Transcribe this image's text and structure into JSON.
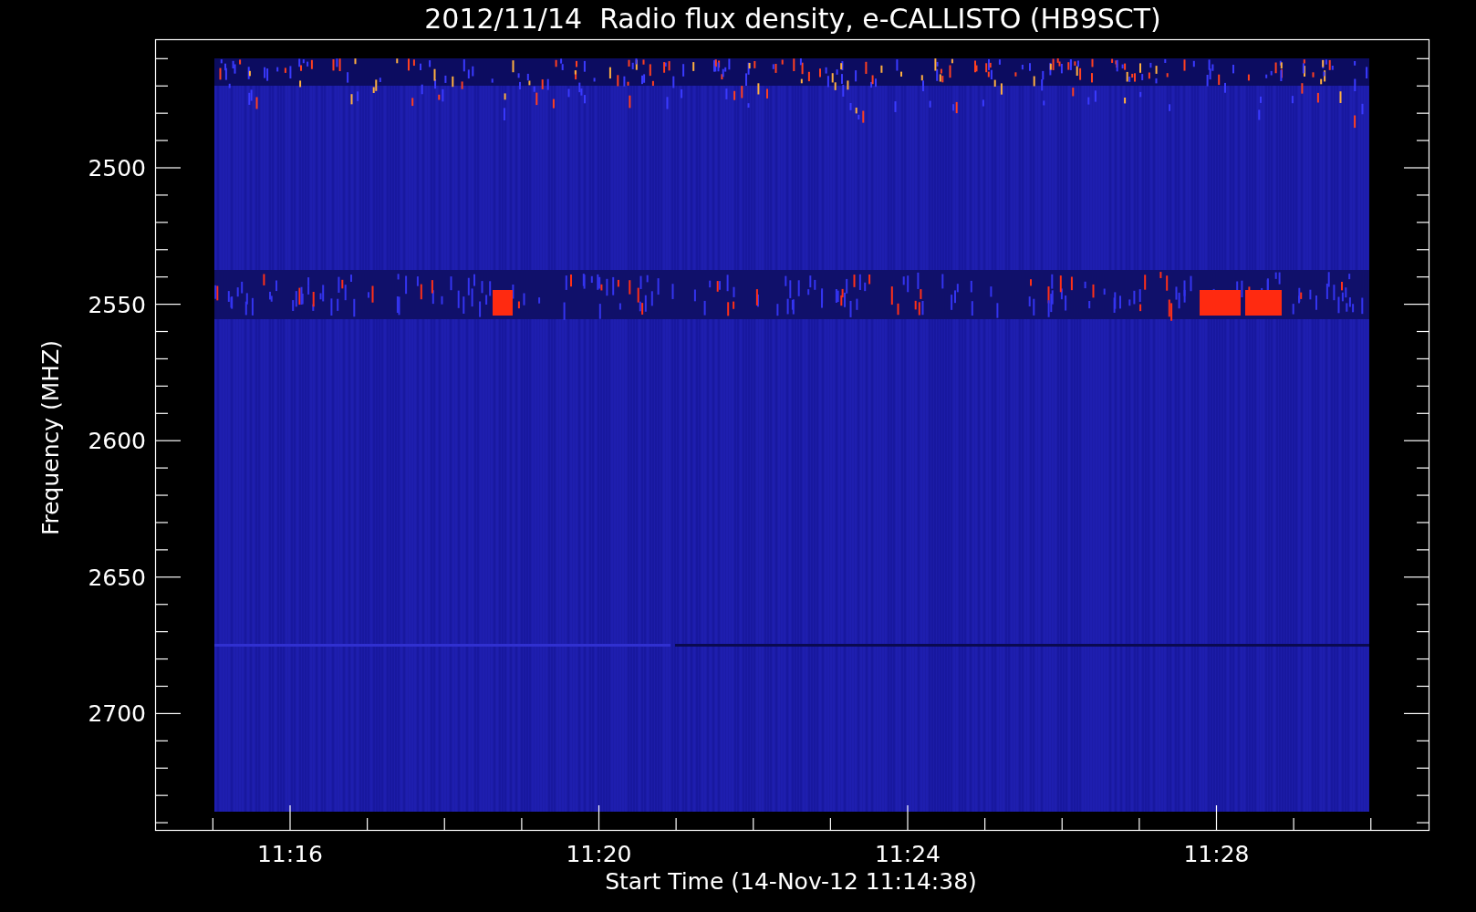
{
  "title": "2012/11/14  Radio flux density, e-CALLISTO (HB9SCT)",
  "y_axis": {
    "label": "Frequency (MHZ)",
    "ticks": [
      "2500",
      "2550",
      "2600",
      "2650",
      "2700"
    ]
  },
  "x_axis": {
    "label": "Start Time (14-Nov-12 11:14:38)",
    "ticks": [
      "11:16",
      "11:20",
      "11:24",
      "11:28"
    ]
  }
}
